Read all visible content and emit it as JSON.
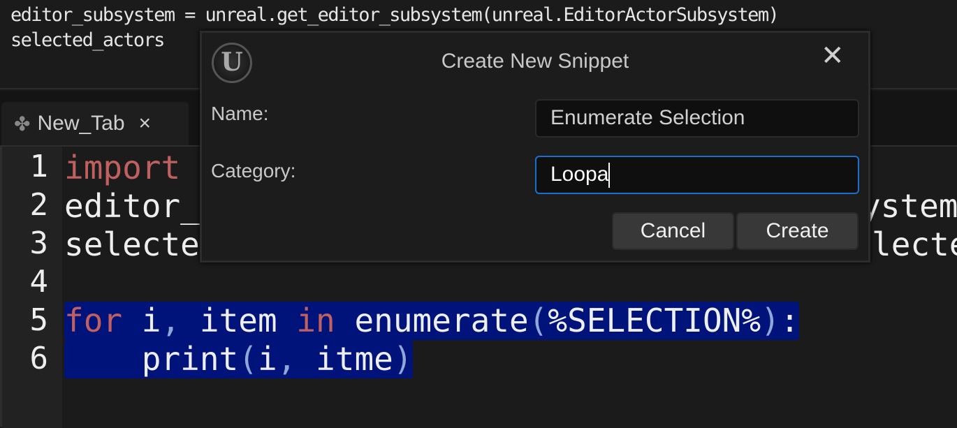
{
  "top_console": {
    "lines": [
      "editor_subsystem = unreal.get_editor_subsystem(unreal.EditorActorSubsystem)",
      "selected_actors"
    ]
  },
  "tab": {
    "label": "New_Tab",
    "close": "×",
    "icon": "python-icon"
  },
  "editor": {
    "line_numbers": [
      "1",
      "2",
      "3",
      "4",
      "5",
      "6"
    ],
    "line1": {
      "kw": "import"
    },
    "line2": {
      "left": "editor_",
      "right": "ystem"
    },
    "line3": {
      "left": "selecte",
      "right": "lecte"
    },
    "line5": {
      "kw1": "for",
      "t1": " i",
      "p1": ",",
      "t2": " item ",
      "kw2": "in",
      "t3": " enumerate",
      "p2": "(",
      "t4": "%SELECTION%",
      "p3": ")",
      "t5": ":"
    },
    "line6": {
      "t1": "    print",
      "p1": "(",
      "t2": "i",
      "p2": ",",
      "t3": " itme",
      "p3": ")"
    },
    "selection_color": "#00137a"
  },
  "dialog": {
    "logo": "U",
    "title": "Create New Snippet",
    "close": "✕",
    "name_label": "Name:",
    "name_value": "Enumerate Selection",
    "category_label": "Category:",
    "category_value": "Loopa",
    "cancel": "Cancel",
    "create": "Create",
    "focus_color": "#1a6fd0"
  }
}
